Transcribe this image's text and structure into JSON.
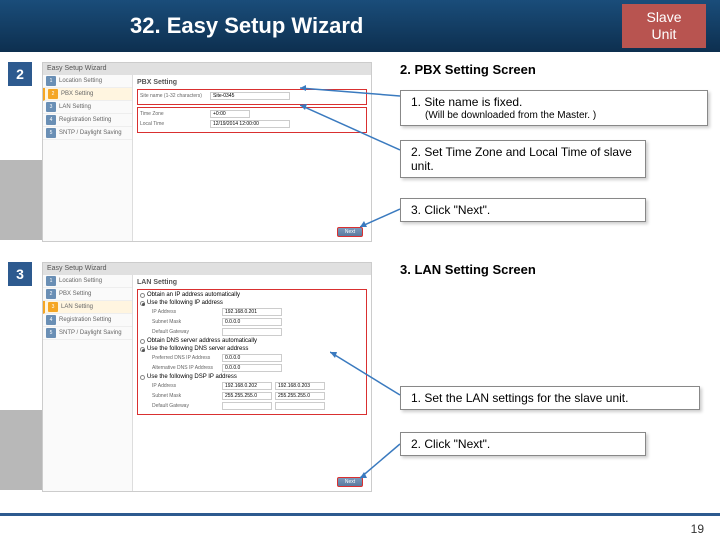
{
  "header": {
    "title": "32. Easy Setup Wizard",
    "slave1": "Slave",
    "slave2": "Unit"
  },
  "section2": {
    "badge": "2",
    "heading": "2. PBX Setting Screen",
    "c1_title": "1.  Site name is fixed.",
    "c1_sub": "(Will be downloaded from the Master. )",
    "c2": "2. Set Time Zone and Local Time of slave unit.",
    "c3": "3. Click \"Next\"."
  },
  "section3": {
    "badge": "3",
    "heading": "3. LAN Setting Screen",
    "c1": "1.  Set the LAN settings for the slave unit.",
    "c2": "2. Click \"Next\"."
  },
  "wizard": {
    "title": "Easy Setup Wizard",
    "steps": [
      "Location Setting",
      "PBX Setting",
      "LAN Setting",
      "Registration Setting",
      "SNTP / Daylight Saving"
    ],
    "pbx": {
      "panel": "PBX Setting",
      "site_label": "Site name (1-32 characters)",
      "site_val": "Site-0345",
      "tz_label": "Time Zone",
      "tz_val": "+0:00",
      "lt_label": "Local Time",
      "lt_val": "12/19/2014 12:00:00"
    },
    "lan": {
      "panel": "LAN Setting",
      "r1": "Obtain an IP address automatically",
      "r2": "Use the following IP address",
      "ip_label": "IP Address",
      "ip_val": "192.168.0.201",
      "mask_label": "Subnet Mask",
      "mask_val": "0.0.0.0",
      "gw_label": "Default Gateway",
      "r3": "Obtain DNS server address automatically",
      "r4": "Use the following DNS server address",
      "dns1_label": "Preferred DNS IP Address",
      "dns1_val": "0.0.0.0",
      "dns2_label": "Alternative DNS IP Address",
      "dns2_val": "0.0.0.0",
      "dsp_check": "Use the following DSP IP address",
      "dsp_ip_label": "IP Address",
      "dsp_mask_label": "Subnet Mask",
      "dsp_gw_label": "Default Gateway",
      "dsp_ip1": "192.168.0.202",
      "dsp_ip2": "192.168.0.203",
      "dsp_mask": "255.255.255.0"
    },
    "next": "Next"
  },
  "footer": {
    "page": "19"
  }
}
